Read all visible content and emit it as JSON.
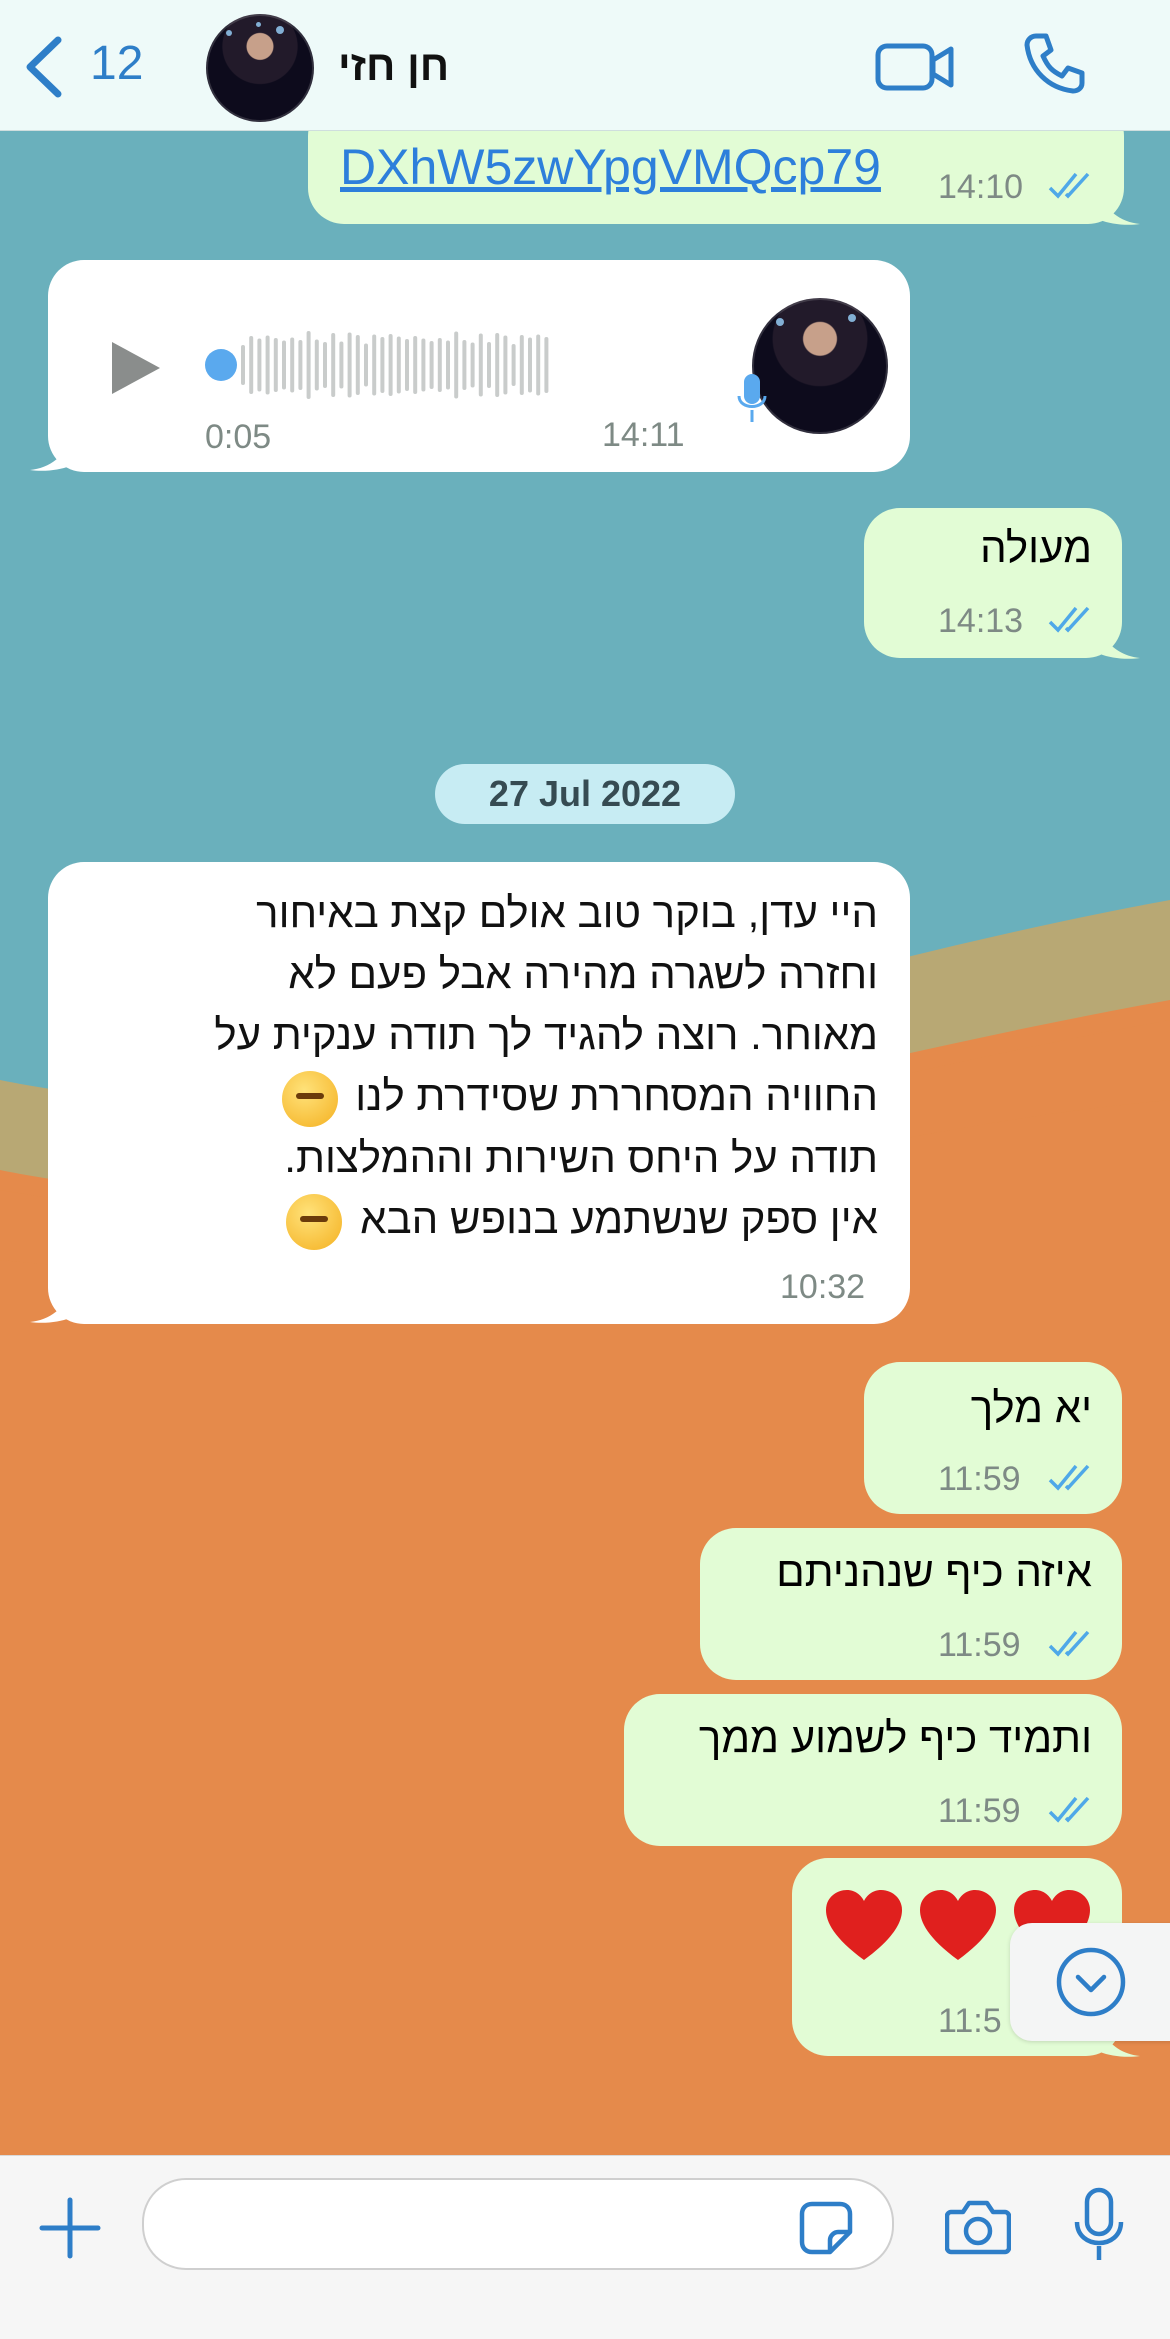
{
  "header": {
    "back_count": "12",
    "contact_name": "חן חזי",
    "accent": "#2e7ec8"
  },
  "messages": [
    {
      "type": "link",
      "direction": "outgoing",
      "text": "DXhW5zwYpgVMQcp79",
      "time": "14:10",
      "status": "read"
    },
    {
      "type": "voice",
      "direction": "incoming",
      "duration": "0:05",
      "time": "14:11"
    },
    {
      "type": "text",
      "direction": "outgoing",
      "text": "מעולה",
      "time": "14:13",
      "status": "read"
    },
    {
      "type": "text",
      "direction": "incoming",
      "lines": [
        "היי עדן, בוקר טוב אולם קצת באיחור",
        "וחזרה לשגרה מהירה אבל פעם לא",
        "מאוחר. רוצה להגיד לך תודה ענקית על",
        "החוויה המסחררת שסידרת לנו",
        "תודה על היחס השירות וההמלצות.",
        "אין ספק שנשתמע בנופש הבא"
      ],
      "time": "10:32"
    },
    {
      "type": "text",
      "direction": "outgoing",
      "text": "יא מלך",
      "time": "11:59",
      "status": "read"
    },
    {
      "type": "text",
      "direction": "outgoing",
      "text": "איזה כיף שנהניתם",
      "time": "11:59",
      "status": "read"
    },
    {
      "type": "text",
      "direction": "outgoing",
      "text": "ותמיד כיף לשמוע ממך",
      "time": "11:59",
      "status": "read"
    },
    {
      "type": "emoji",
      "direction": "outgoing",
      "emoji": [
        "heart",
        "heart",
        "heart"
      ],
      "time": "11:5"
    }
  ],
  "date_separator": "27 Jul 2022",
  "composer": {
    "placeholder": ""
  },
  "icons": {
    "header": [
      "back-chevron-icon",
      "video-call-icon",
      "phone-icon"
    ],
    "composer": [
      "plus-icon",
      "sticker-icon",
      "camera-icon",
      "microphone-icon"
    ],
    "scroll": "scroll-down-icon"
  },
  "colors": {
    "outgoing_bubble": "#e2fcd5",
    "incoming_bubble": "#ffffff",
    "read_ticks": "#4fa8e8",
    "wallpaper_top": "#6ab0bc",
    "wallpaper_bottom": "#e58a4b"
  }
}
